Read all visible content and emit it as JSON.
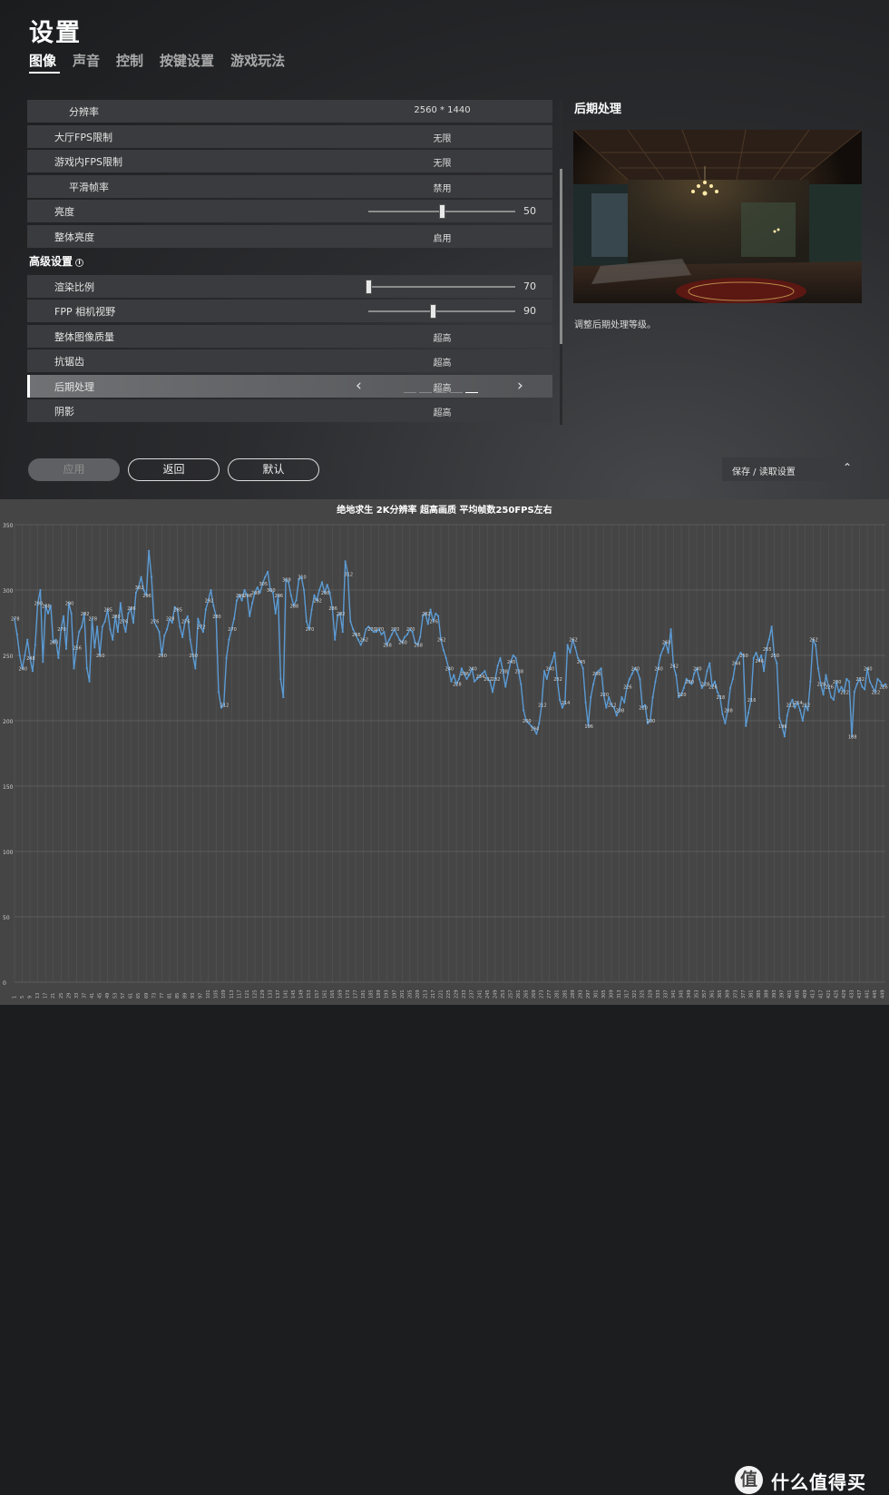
{
  "header": {
    "title": "设置"
  },
  "tabs": [
    {
      "label": "图像",
      "active": true
    },
    {
      "label": "声音",
      "active": false
    },
    {
      "label": "控制",
      "active": false
    },
    {
      "label": "按键设置",
      "active": false
    },
    {
      "label": "游戏玩法",
      "active": false
    }
  ],
  "settings": {
    "resolution": {
      "label": "分辨率",
      "value": "2560 * 1440"
    },
    "lobby_fps": {
      "label": "大厅FPS限制",
      "value": "无限"
    },
    "ingame_fps": {
      "label": "游戏内FPS限制",
      "value": "无限"
    },
    "smoothing": {
      "label": "平滑帧率",
      "value": "禁用"
    },
    "brightness": {
      "label": "亮度",
      "value": "50",
      "level": 0.5
    },
    "overall_brightness": {
      "label": "整体亮度",
      "value": "启用"
    },
    "advanced_title": "高级设置",
    "render_scale": {
      "label": "渲染比例",
      "value": "70",
      "level": 0.0
    },
    "fpp_fov": {
      "label": "FPP 相机视野",
      "value": "90",
      "level": 0.44
    },
    "overall_quality": {
      "label": "整体图像质量",
      "value": "超高"
    },
    "antialiasing": {
      "label": "抗锯齿",
      "value": "超高"
    },
    "post_processing": {
      "label": "后期处理",
      "value": "超高",
      "level_index": 4,
      "level_count": 5
    },
    "shadows": {
      "label": "阴影",
      "value": "超高"
    }
  },
  "preview": {
    "title": "后期处理",
    "description": "调整后期处理等级。"
  },
  "buttons": {
    "apply": "应用",
    "back": "返回",
    "default": "默认",
    "save_load": "保存 / 读取设置"
  },
  "watermark": {
    "logo": "值",
    "text": "什么值得买"
  },
  "chart_data": {
    "type": "line",
    "title": "绝地求生 2K分辨率 超高画质 平均帧数250FPS左右",
    "ylim": [
      0,
      350
    ],
    "yticks": [
      0,
      50,
      100,
      150,
      200,
      250,
      300,
      350
    ],
    "grid": true,
    "color": "#5b9bd5",
    "x_start": 1,
    "x_step": 4,
    "values": [
      278,
      266,
      250,
      240,
      250,
      262,
      248,
      238,
      258,
      290,
      300,
      245,
      288,
      282,
      288,
      260,
      262,
      248,
      270,
      280,
      255,
      290,
      282,
      240,
      256,
      268,
      272,
      282,
      240,
      230,
      278,
      256,
      272,
      250,
      272,
      276,
      285,
      270,
      262,
      280,
      268,
      290,
      276,
      268,
      282,
      286,
      275,
      298,
      302,
      310,
      300,
      296,
      330,
      310,
      276,
      272,
      268,
      250,
      265,
      270,
      278,
      275,
      287,
      285,
      272,
      264,
      276,
      280,
      262,
      250,
      240,
      278,
      272,
      268,
      285,
      292,
      300,
      288,
      280,
      222,
      210,
      212,
      248,
      262,
      270,
      278,
      292,
      296,
      292,
      300,
      296,
      280,
      290,
      298,
      302,
      298,
      305,
      310,
      314,
      300,
      298,
      282,
      296,
      232,
      218,
      308,
      306,
      296,
      288,
      292,
      308,
      310,
      300,
      276,
      270,
      285,
      296,
      292,
      300,
      306,
      298,
      304,
      298,
      286,
      262,
      280,
      282,
      268,
      322,
      312,
      276,
      270,
      266,
      262,
      258,
      262,
      270,
      272,
      270,
      268,
      268,
      270,
      266,
      268,
      258,
      262,
      266,
      270,
      266,
      262,
      260,
      264,
      266,
      270,
      268,
      260,
      258,
      264,
      280,
      282,
      274,
      285,
      276,
      282,
      280,
      262,
      254,
      248,
      240,
      230,
      235,
      228,
      232,
      240,
      236,
      232,
      235,
      240,
      230,
      232,
      234,
      236,
      238,
      232,
      230,
      222,
      232,
      242,
      248,
      238,
      226,
      236,
      245,
      250,
      248,
      238,
      228,
      208,
      200,
      198,
      196,
      194,
      190,
      198,
      212,
      238,
      232,
      240,
      245,
      252,
      232,
      216,
      210,
      214,
      258,
      252,
      262,
      256,
      248,
      245,
      240,
      214,
      196,
      218,
      228,
      236,
      238,
      240,
      220,
      210,
      218,
      212,
      210,
      204,
      208,
      218,
      214,
      226,
      232,
      236,
      240,
      238,
      232,
      210,
      212,
      198,
      200,
      218,
      230,
      240,
      250,
      255,
      260,
      252,
      270,
      242,
      235,
      218,
      220,
      225,
      232,
      230,
      228,
      236,
      240,
      232,
      225,
      228,
      238,
      244,
      226,
      230,
      222,
      218,
      205,
      198,
      208,
      225,
      232,
      244,
      248,
      252,
      250,
      196,
      206,
      216,
      248,
      252,
      246,
      250,
      238,
      255,
      262,
      272,
      250,
      244,
      202,
      196,
      188,
      204,
      212,
      216,
      210,
      214,
      208,
      200,
      212,
      208,
      230,
      262,
      258,
      240,
      228,
      220,
      235,
      226,
      218,
      216,
      230,
      222,
      226,
      222,
      232,
      230,
      188,
      222,
      228,
      232,
      226,
      224,
      240,
      230,
      226,
      222,
      232,
      230,
      226,
      228
    ]
  }
}
